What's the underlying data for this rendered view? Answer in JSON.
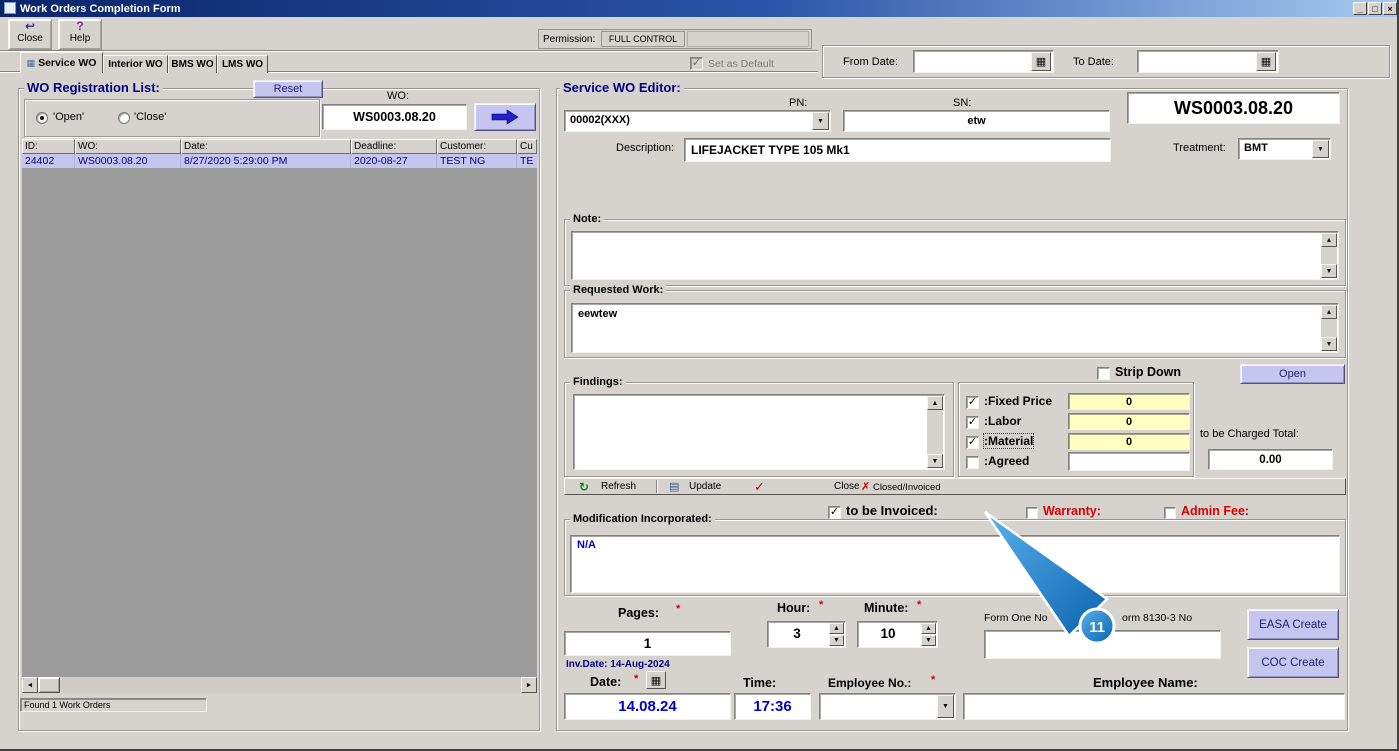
{
  "window": {
    "title": "Work Orders Completion Form"
  },
  "icons": {
    "minimize": "_",
    "maximize": "□",
    "close_x": "×",
    "exit": "↩",
    "help": "?",
    "tab": "▦",
    "calendar": "▦",
    "dropdown": "▼",
    "spin_up": "▲",
    "spin_down": "▼",
    "scroll_left": "◄",
    "scroll_right": "►",
    "scroll_up": "▲",
    "scroll_down": "▼",
    "refresh": "↻",
    "update": "▤",
    "check": "✓",
    "cross": "✗"
  },
  "ui": {
    "asterisk": "*"
  },
  "colors": {
    "accent_lavender": "#c5c5ef",
    "highlight_row": "#c5c5ee",
    "value_yellow": "#ffffc2",
    "annotation_blue": "#1b7fd0",
    "navy": "#000080",
    "red": "#d60000"
  },
  "toolbar": {
    "close": "Close",
    "help": "Help",
    "permission_label": "Permission:",
    "permission_value": "FULL CONTROL",
    "set_default": "Set as Default"
  },
  "date_range": {
    "from_label": "From Date:",
    "from_value": "",
    "to_label": "To Date:",
    "to_value": ""
  },
  "tabs": {
    "service": "Service WO",
    "interior": "Interior WO",
    "bms": "BMS WO",
    "lms": "LMS WO"
  },
  "registration": {
    "title": "WO Registration List:",
    "reset": "Reset",
    "open_radio": "'Open'",
    "close_radio": "'Close'",
    "wo_label": "WO:",
    "wo_value": "WS0003.08.20",
    "columns": [
      "ID:",
      "WO:",
      "Date:",
      "Deadline:",
      "Customer:",
      "Cu"
    ],
    "row": [
      "24402",
      "WS0003.08.20",
      "8/27/2020 5:29:00 PM",
      "2020-08-27",
      "TEST NG",
      "TE"
    ],
    "status": "Found 1 Work Orders"
  },
  "editor": {
    "title": "Service WO Editor:",
    "pn_label": "PN:",
    "pn_value": "00002(XXX)",
    "sn_label": "SN:",
    "sn_value": "etw",
    "wo_display": "WS0003.08.20",
    "description_label": "Description:",
    "description_value": "LIFEJACKET TYPE 105 Mk1",
    "treatment_label": "Treatment:",
    "treatment_value": "BMT",
    "note_label": "Note:",
    "note_value": "",
    "requested_label": "Requested Work:",
    "requested_value": "eewtew",
    "strip_down": "Strip Down",
    "open_btn": "Open",
    "findings_label": "Findings:",
    "findings_value": ""
  },
  "charges": {
    "fixed_label": ":Fixed Price",
    "fixed_value": "0",
    "labor_label": ":Labor",
    "labor_value": "0",
    "material_label": ":Material",
    "material_value": "0",
    "agreed_label": ":Agreed",
    "agreed_value": "",
    "total_label": "to be Charged Total:",
    "total_value": "0.00"
  },
  "actions": {
    "refresh": "Refresh",
    "update": "Update",
    "close": "Close",
    "closed_invoiced": "Closed/Invoiced"
  },
  "flags": {
    "invoiced": "to be Invoiced:",
    "warranty": "Warranty:",
    "admin_fee": "Admin Fee:"
  },
  "modification": {
    "label": "Modification Incorporated:",
    "value": "N/A"
  },
  "footer": {
    "pages_label": "Pages:",
    "pages_value": "1",
    "hour_label": "Hour:",
    "hour_value": "3",
    "minute_label": "Minute:",
    "minute_value": "10",
    "form_one_label": "Form One No",
    "form_8130_label": "orm 8130-3 No",
    "form_value": "",
    "easa_btn": "EASA Create",
    "coc_btn": "COC Create",
    "inv_date": "Inv.Date: 14-Aug-2024",
    "date_label": "Date:",
    "date_value": "14.08.24",
    "time_label": "Time:",
    "time_value": "17:36",
    "employee_no_label": "Employee No.:",
    "employee_no_value": "",
    "employee_name_label": "Employee Name:",
    "employee_name_value": ""
  },
  "annotation": {
    "badge": "11"
  }
}
